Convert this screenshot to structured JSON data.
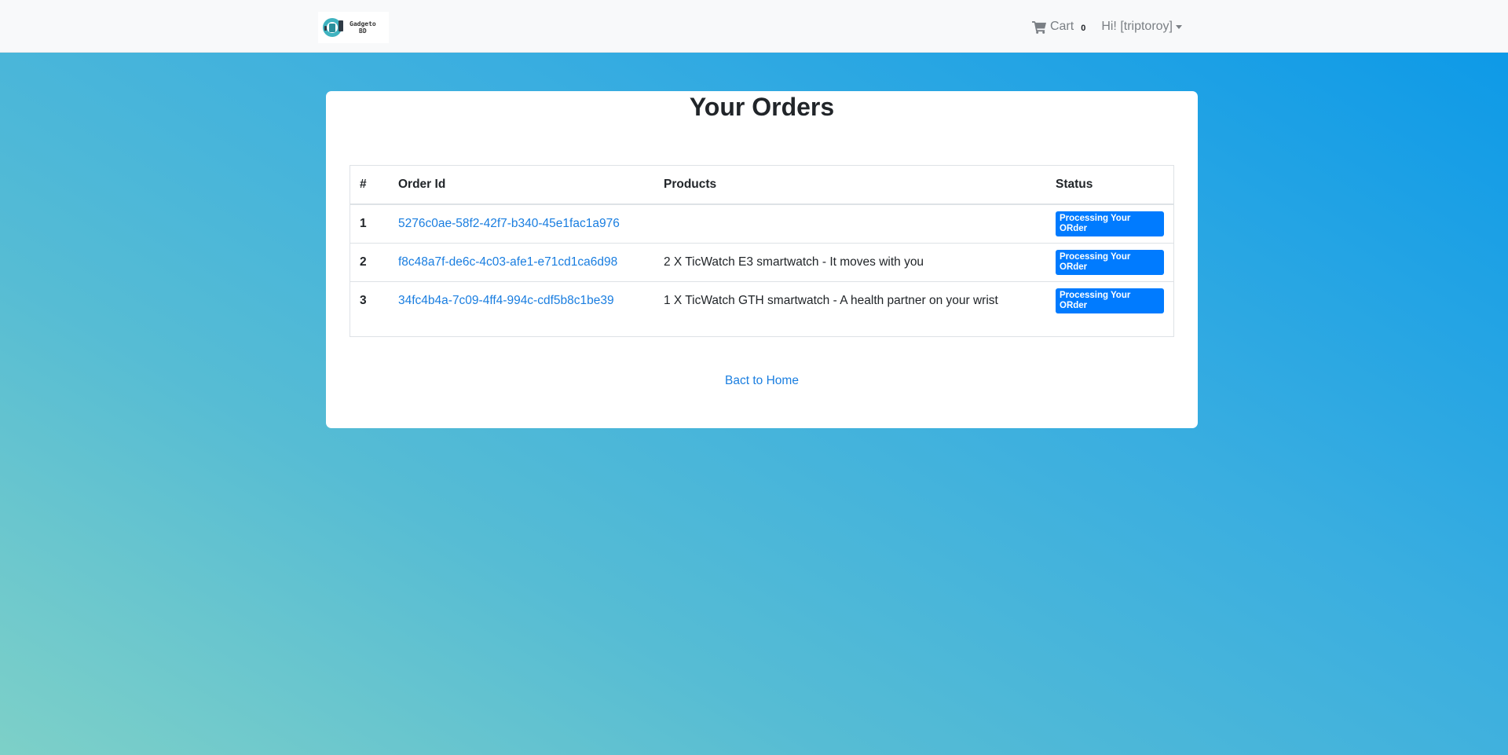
{
  "navbar": {
    "brand_text_line1": "Gadgeto",
    "brand_text_line2": "BD",
    "cart_label": "Cart",
    "cart_count": "0",
    "user_label": "Hi! [triptoroy]"
  },
  "main": {
    "title": "Your Orders",
    "table": {
      "headers": [
        "#",
        "Order Id",
        "Products",
        "Status"
      ],
      "rows": [
        {
          "index": "1",
          "order_id": "5276c0ae-58f2-42f7-b340-45e1fac1a976",
          "products": "",
          "status": "Processing Your ORder"
        },
        {
          "index": "2",
          "order_id": "f8c48a7f-de6c-4c03-afe1-e71cd1ca6d98",
          "products": "2 X TicWatch E3 smartwatch - It moves with you",
          "status": "Processing Your ORder"
        },
        {
          "index": "3",
          "order_id": "34fc4b4a-7c09-4ff4-994c-cdf5b8c1be39",
          "products": "1 X TicWatch GTH smartwatch - A health partner on your wrist",
          "status": "Processing Your ORder"
        }
      ]
    },
    "home_link": "Bact to Home"
  },
  "colors": {
    "navbar_bg": "#f8f9fa",
    "link": "#1a7ee0",
    "badge": "#007bff",
    "gradient_start": "#7dd0c8",
    "gradient_end": "#0a98e8"
  }
}
